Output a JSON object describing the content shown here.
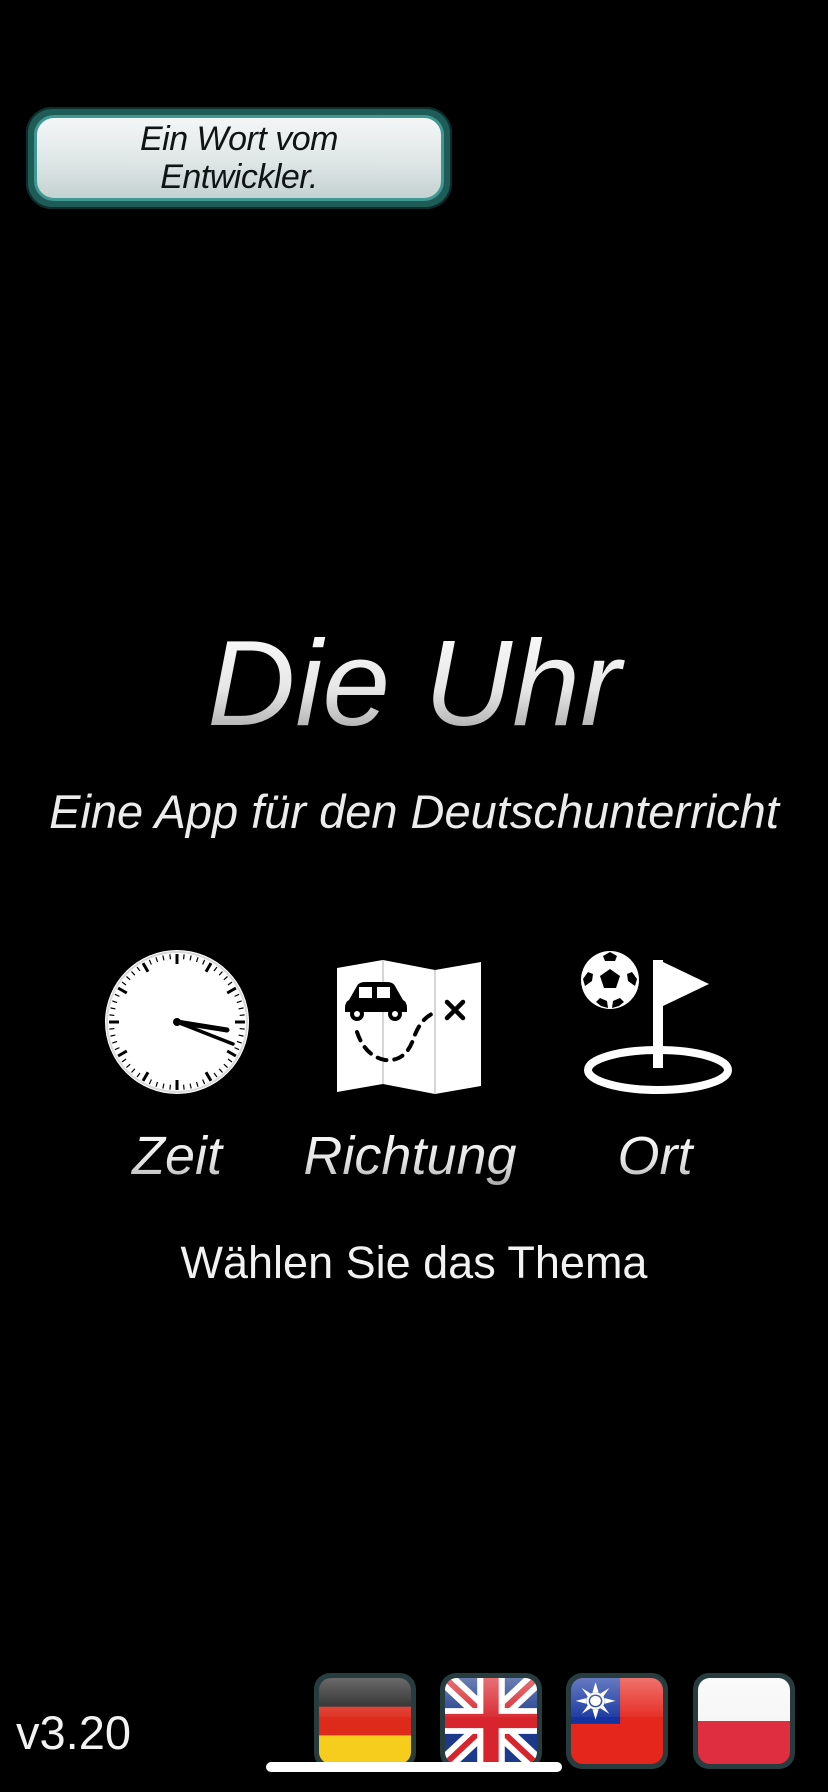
{
  "developer_button": {
    "label": "Ein Wort vom Entwickler."
  },
  "app": {
    "title": "Die Uhr",
    "subtitle": "Eine App für den Deutschunterricht"
  },
  "topics": [
    {
      "label": "Zeit",
      "icon": "clock-icon"
    },
    {
      "label": "Richtung",
      "icon": "map-route-icon"
    },
    {
      "label": "Ort",
      "icon": "location-flag-icon"
    }
  ],
  "prompt": "Wählen Sie das Thema",
  "version": "v3.20",
  "languages": [
    {
      "icon": "german-flag-icon"
    },
    {
      "icon": "uk-flag-icon"
    },
    {
      "icon": "taiwan-flag-icon"
    },
    {
      "icon": "poland-flag-icon"
    }
  ],
  "colors": {
    "background": "#000000",
    "button_border": "#1f5c58",
    "button_face": "#dfe6e6",
    "text": "#ffffff"
  }
}
